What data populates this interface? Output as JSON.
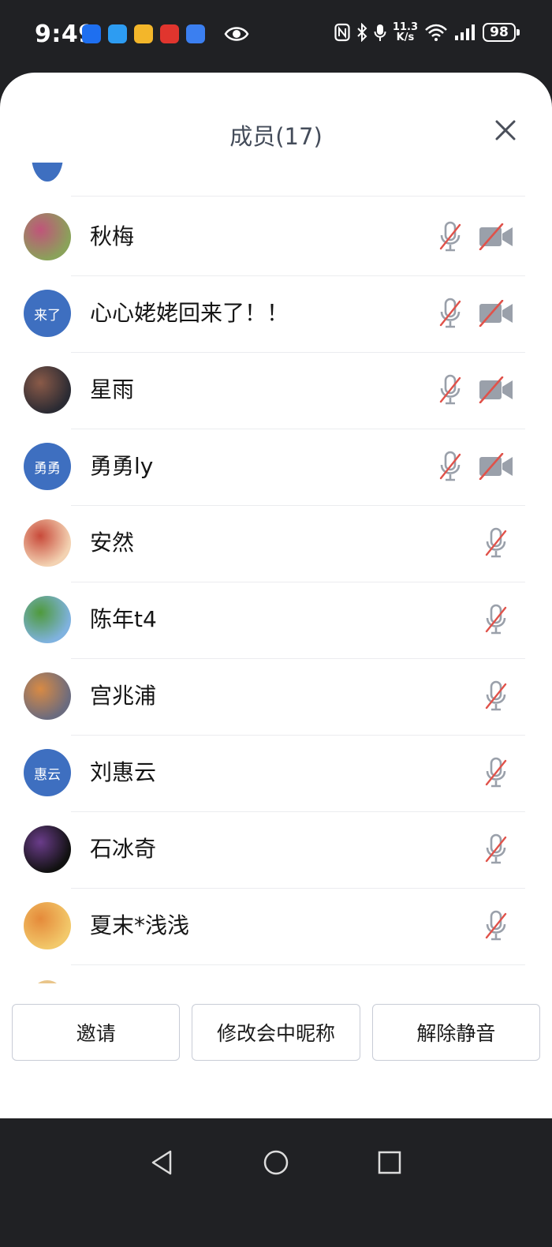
{
  "status_bar": {
    "time": "9:49",
    "net_speed_value": "11.3",
    "net_speed_unit": "K/s",
    "battery": "98",
    "app_icons": [
      "maps-app-icon",
      "messages-app-icon",
      "mail-app-icon",
      "shopping-app-icon",
      "security-app-icon"
    ]
  },
  "dialog": {
    "title": "成员(17)"
  },
  "members": [
    {
      "name": "秋梅",
      "avatar_type": "photo",
      "avatar_colors": [
        "#8aa25a",
        "#c0547a"
      ],
      "mic_muted": true,
      "camera_off": true
    },
    {
      "name": "心心姥姥回来了！！",
      "avatar_type": "initials",
      "avatar_text": "来了",
      "mic_muted": true,
      "camera_off": true
    },
    {
      "name": "星雨",
      "avatar_type": "photo",
      "avatar_colors": [
        "#2b2b33",
        "#8a5a48"
      ],
      "mic_muted": true,
      "camera_off": true
    },
    {
      "name": "勇勇ly",
      "avatar_type": "initials",
      "avatar_text": "勇勇",
      "mic_muted": true,
      "camera_off": true
    },
    {
      "name": "安然",
      "avatar_type": "photo",
      "avatar_colors": [
        "#f3d2b2",
        "#c84a3a"
      ],
      "mic_muted": true,
      "camera_off": false
    },
    {
      "name": "陈年t4",
      "avatar_type": "photo",
      "avatar_colors": [
        "#7fb2df",
        "#4f9a3c"
      ],
      "mic_muted": true,
      "camera_off": false
    },
    {
      "name": "宫兆浦",
      "avatar_type": "photo",
      "avatar_colors": [
        "#6b6b7e",
        "#d88a44"
      ],
      "mic_muted": true,
      "camera_off": false
    },
    {
      "name": "刘惠云",
      "avatar_type": "initials",
      "avatar_text": "惠云",
      "mic_muted": true,
      "camera_off": false
    },
    {
      "name": "石冰奇",
      "avatar_type": "photo",
      "avatar_colors": [
        "#111111",
        "#6a3c8a"
      ],
      "mic_muted": true,
      "camera_off": false
    },
    {
      "name": "夏末*浅浅",
      "avatar_type": "photo",
      "avatar_colors": [
        "#f2c86a",
        "#e58a3a"
      ],
      "mic_muted": true,
      "camera_off": false
    }
  ],
  "actions": {
    "invite": "邀请",
    "rename": "修改会中昵称",
    "unmute": "解除静音"
  },
  "colors": {
    "accent_blue": "#3e6fc0",
    "muted_slash": "#e0524a",
    "icon_gray": "#9aa0aa"
  }
}
